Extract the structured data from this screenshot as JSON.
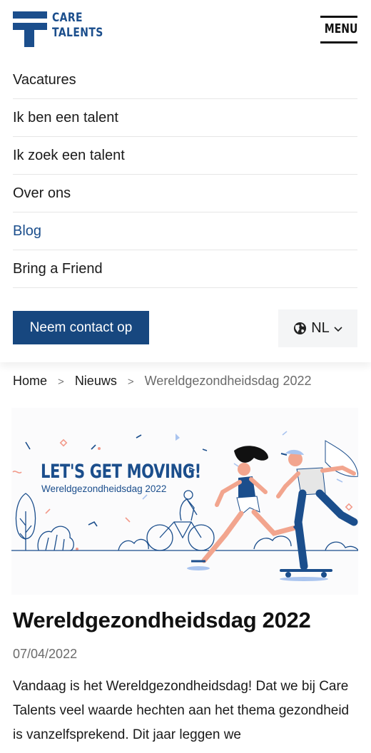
{
  "brand": {
    "line1": "CARE",
    "line2": "TALENTS",
    "color": "#1b4e8c"
  },
  "header": {
    "menu_label": "MENU"
  },
  "nav": {
    "items": [
      {
        "label": "Vacatures"
      },
      {
        "label": "Ik ben een talent"
      },
      {
        "label": "Ik zoek een talent"
      },
      {
        "label": "Over ons"
      },
      {
        "label": "Blog",
        "active": true
      },
      {
        "label": "Bring a Friend"
      }
    ]
  },
  "actions": {
    "contact_label": "Neem contact op",
    "language": "NL",
    "language_icon": "globe-icon",
    "dropdown_icon": "chevron-down-icon"
  },
  "breadcrumb": {
    "home": "Home",
    "section": "Nieuws",
    "current": "Wereldgezondheidsdag 2022"
  },
  "hero": {
    "headline": "LET'S GET MOVING!",
    "subline": "Wereldgezondheidsdag 2022"
  },
  "article": {
    "title": "Wereldgezondheidsdag 2022",
    "date": "07/04/2022",
    "body": "Vandaag is het Wereldgezondheidsdag! Dat we bij Care Talents veel waarde hechten aan het thema gezondheid is vanzelfsprekend. Dit jaar leggen we"
  },
  "colors": {
    "primary": "#17477f",
    "accent": "#1b4e8c",
    "hero_background": "#fbfbfc",
    "illustration_light_blue": "#a9c4ef"
  }
}
